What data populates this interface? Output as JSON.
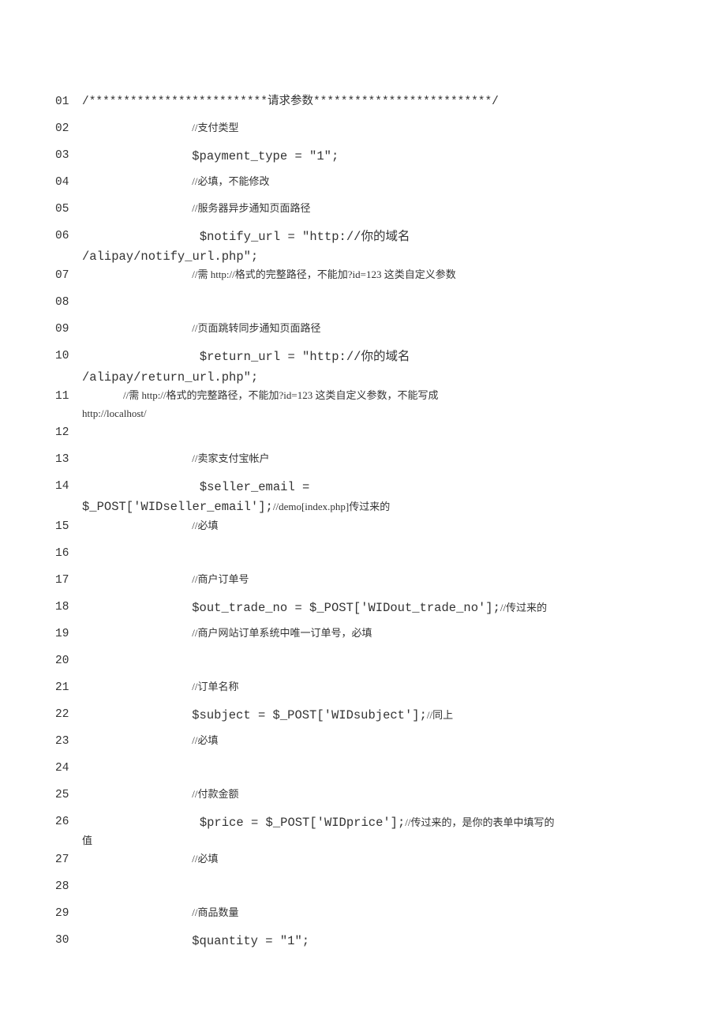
{
  "lines": [
    {
      "no": "01",
      "prefix": "",
      "parts": [
        {
          "cls": "",
          "text": "/**************************请求参数**************************/"
        }
      ]
    },
    {
      "no": "02",
      "prefix": "                ",
      "parts": [
        {
          "cls": "cn-comment",
          "text": "//支付类型"
        }
      ]
    },
    {
      "no": "03",
      "prefix": "                ",
      "parts": [
        {
          "cls": "big",
          "text": "$payment_type = \"1\";"
        }
      ]
    },
    {
      "no": "04",
      "prefix": "                ",
      "parts": [
        {
          "cls": "cn-comment",
          "text": "//必填，不能修改"
        }
      ]
    },
    {
      "no": "05",
      "prefix": "                ",
      "parts": [
        {
          "cls": "cn-comment",
          "text": "//服务器异步通知页面路径"
        }
      ]
    },
    {
      "no": "06",
      "prefix": "",
      "parts": [
        {
          "cls": "big",
          "text": "                $notify_url = \"http://你的域名\n/alipay/notify_url.php\";"
        }
      ],
      "multi": true
    },
    {
      "no": "07",
      "prefix": "                ",
      "parts": [
        {
          "cls": "cn-comment",
          "text": "//需 http://格式的完整路径，不能加?id=123 这类自定义参数"
        }
      ]
    },
    {
      "no": "08",
      "prefix": "",
      "parts": [
        {
          "cls": "",
          "text": ""
        }
      ]
    },
    {
      "no": "09",
      "prefix": "                ",
      "parts": [
        {
          "cls": "cn-comment",
          "text": "//页面跳转同步通知页面路径"
        }
      ]
    },
    {
      "no": "10",
      "prefix": "",
      "parts": [
        {
          "cls": "big",
          "text": "                $return_url = \"http://你的域名\n/alipay/return_url.php\";"
        }
      ],
      "multi": true
    },
    {
      "no": "11",
      "prefix": "",
      "parts": [
        {
          "cls": "cn-comment",
          "text": "                //需 http://格式的完整路径，不能加?id=123 这类自定义参数，不能写成\nhttp://localhost/"
        }
      ],
      "multi": true
    },
    {
      "no": "12",
      "prefix": "",
      "parts": [
        {
          "cls": "",
          "text": ""
        }
      ]
    },
    {
      "no": "13",
      "prefix": "                ",
      "parts": [
        {
          "cls": "cn-comment",
          "text": "//卖家支付宝帐户"
        }
      ]
    },
    {
      "no": "14",
      "prefix": "",
      "parts": [
        {
          "cls": "big",
          "text": "                $seller_email =\n$_POST['WIDseller_email'];"
        },
        {
          "cls": "cn-comment",
          "text": "//demo[index.php]传过来的"
        }
      ],
      "multi": true
    },
    {
      "no": "15",
      "prefix": "                ",
      "parts": [
        {
          "cls": "cn-comment",
          "text": "//必填"
        }
      ]
    },
    {
      "no": "16",
      "prefix": "",
      "parts": [
        {
          "cls": "",
          "text": ""
        }
      ]
    },
    {
      "no": "17",
      "prefix": "                ",
      "parts": [
        {
          "cls": "cn-comment",
          "text": "//商户订单号"
        }
      ]
    },
    {
      "no": "18",
      "prefix": "                ",
      "parts": [
        {
          "cls": "big",
          "text": "$out_trade_no = $_POST['WIDout_trade_no'];"
        },
        {
          "cls": "cn-comment",
          "text": "//传过来的"
        }
      ]
    },
    {
      "no": "19",
      "prefix": "                ",
      "parts": [
        {
          "cls": "cn-comment",
          "text": "//商户网站订单系统中唯一订单号，必填"
        }
      ]
    },
    {
      "no": "20",
      "prefix": "",
      "parts": [
        {
          "cls": "",
          "text": ""
        }
      ]
    },
    {
      "no": "21",
      "prefix": "                ",
      "parts": [
        {
          "cls": "cn-comment",
          "text": "//订单名称"
        }
      ]
    },
    {
      "no": "22",
      "prefix": "                ",
      "parts": [
        {
          "cls": "big",
          "text": "$subject = $_POST['WIDsubject'];"
        },
        {
          "cls": "cn-comment",
          "text": "//同上"
        }
      ]
    },
    {
      "no": "23",
      "prefix": "                ",
      "parts": [
        {
          "cls": "cn-comment",
          "text": "//必填"
        }
      ]
    },
    {
      "no": "24",
      "prefix": "",
      "parts": [
        {
          "cls": "",
          "text": ""
        }
      ]
    },
    {
      "no": "25",
      "prefix": "                ",
      "parts": [
        {
          "cls": "cn-comment",
          "text": "//付款金额"
        }
      ]
    },
    {
      "no": "26",
      "prefix": "",
      "parts": [
        {
          "cls": "big",
          "text": "                $price = $_POST['WIDprice'];"
        },
        {
          "cls": "cn-comment",
          "text": "//传过来的，是你的表单中填写的\n值"
        }
      ],
      "multi": true
    },
    {
      "no": "27",
      "prefix": "                ",
      "parts": [
        {
          "cls": "cn-comment",
          "text": "//必填"
        }
      ]
    },
    {
      "no": "28",
      "prefix": "",
      "parts": [
        {
          "cls": "",
          "text": ""
        }
      ]
    },
    {
      "no": "29",
      "prefix": "                ",
      "parts": [
        {
          "cls": "cn-comment",
          "text": "//商品数量"
        }
      ]
    },
    {
      "no": "30",
      "prefix": "                ",
      "parts": [
        {
          "cls": "big",
          "text": "$quantity = \"1\";"
        }
      ]
    }
  ]
}
